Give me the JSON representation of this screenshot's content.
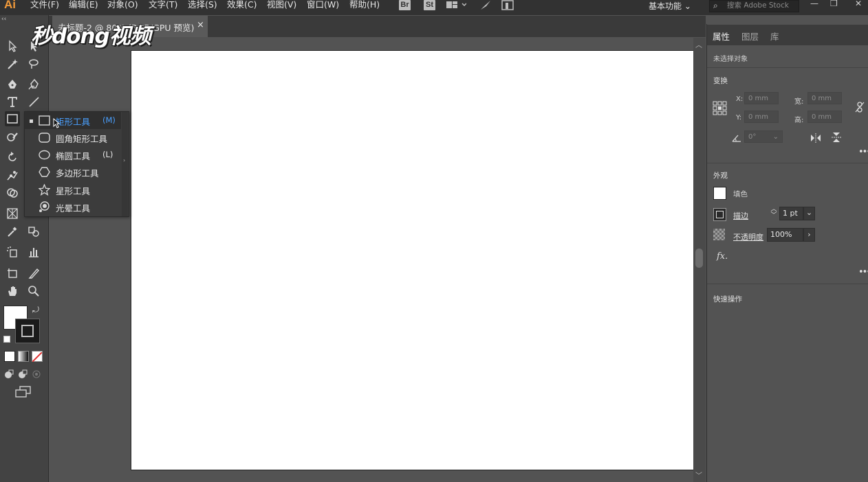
{
  "app": {
    "logo": "Ai"
  },
  "menu": [
    "文件(F)",
    "编辑(E)",
    "对象(O)",
    "文字(T)",
    "选择(S)",
    "效果(C)",
    "视图(V)",
    "窗口(W)",
    "帮助(H)"
  ],
  "top_icons": {
    "bridge": "Br",
    "stock": "St"
  },
  "workspace": "基本功能",
  "search": {
    "placeholder": "搜索 Adobe Stock",
    "value": ""
  },
  "document": {
    "tab_title": "未标题-2 @ 80% (RGB/GPU 预览)",
    "close": "×"
  },
  "watermark": "秒dong视频",
  "flyout": [
    {
      "label": "矩形工具",
      "key": "(M)",
      "icon": "rectangle-icon",
      "selected": true
    },
    {
      "label": "圆角矩形工具",
      "key": "",
      "icon": "rounded-rectangle-icon"
    },
    {
      "label": "椭圆工具",
      "key": "(L)",
      "icon": "ellipse-icon"
    },
    {
      "label": "多边形工具",
      "key": "",
      "icon": "polygon-icon"
    },
    {
      "label": "星形工具",
      "key": "",
      "icon": "star-icon"
    },
    {
      "label": "光晕工具",
      "key": "",
      "icon": "flare-icon"
    }
  ],
  "panel": {
    "tabs": [
      "属性",
      "图层",
      "库"
    ],
    "no_selection": "未选择对象",
    "transform": {
      "title": "变换",
      "x_label": "X:",
      "x_value": "0 mm",
      "y_label": "Y:",
      "y_value": "0 mm",
      "w_label": "宽:",
      "w_value": "0 mm",
      "h_label": "高:",
      "h_value": "0 mm",
      "angle_value": "0°"
    },
    "appearance": {
      "title": "外观",
      "fill_label": "填色",
      "stroke_label": "描边",
      "stroke_value": "1 pt",
      "opacity_label": "不透明度",
      "opacity_value": "100%",
      "fx_label": "fx."
    },
    "quick_actions": "快速操作"
  }
}
